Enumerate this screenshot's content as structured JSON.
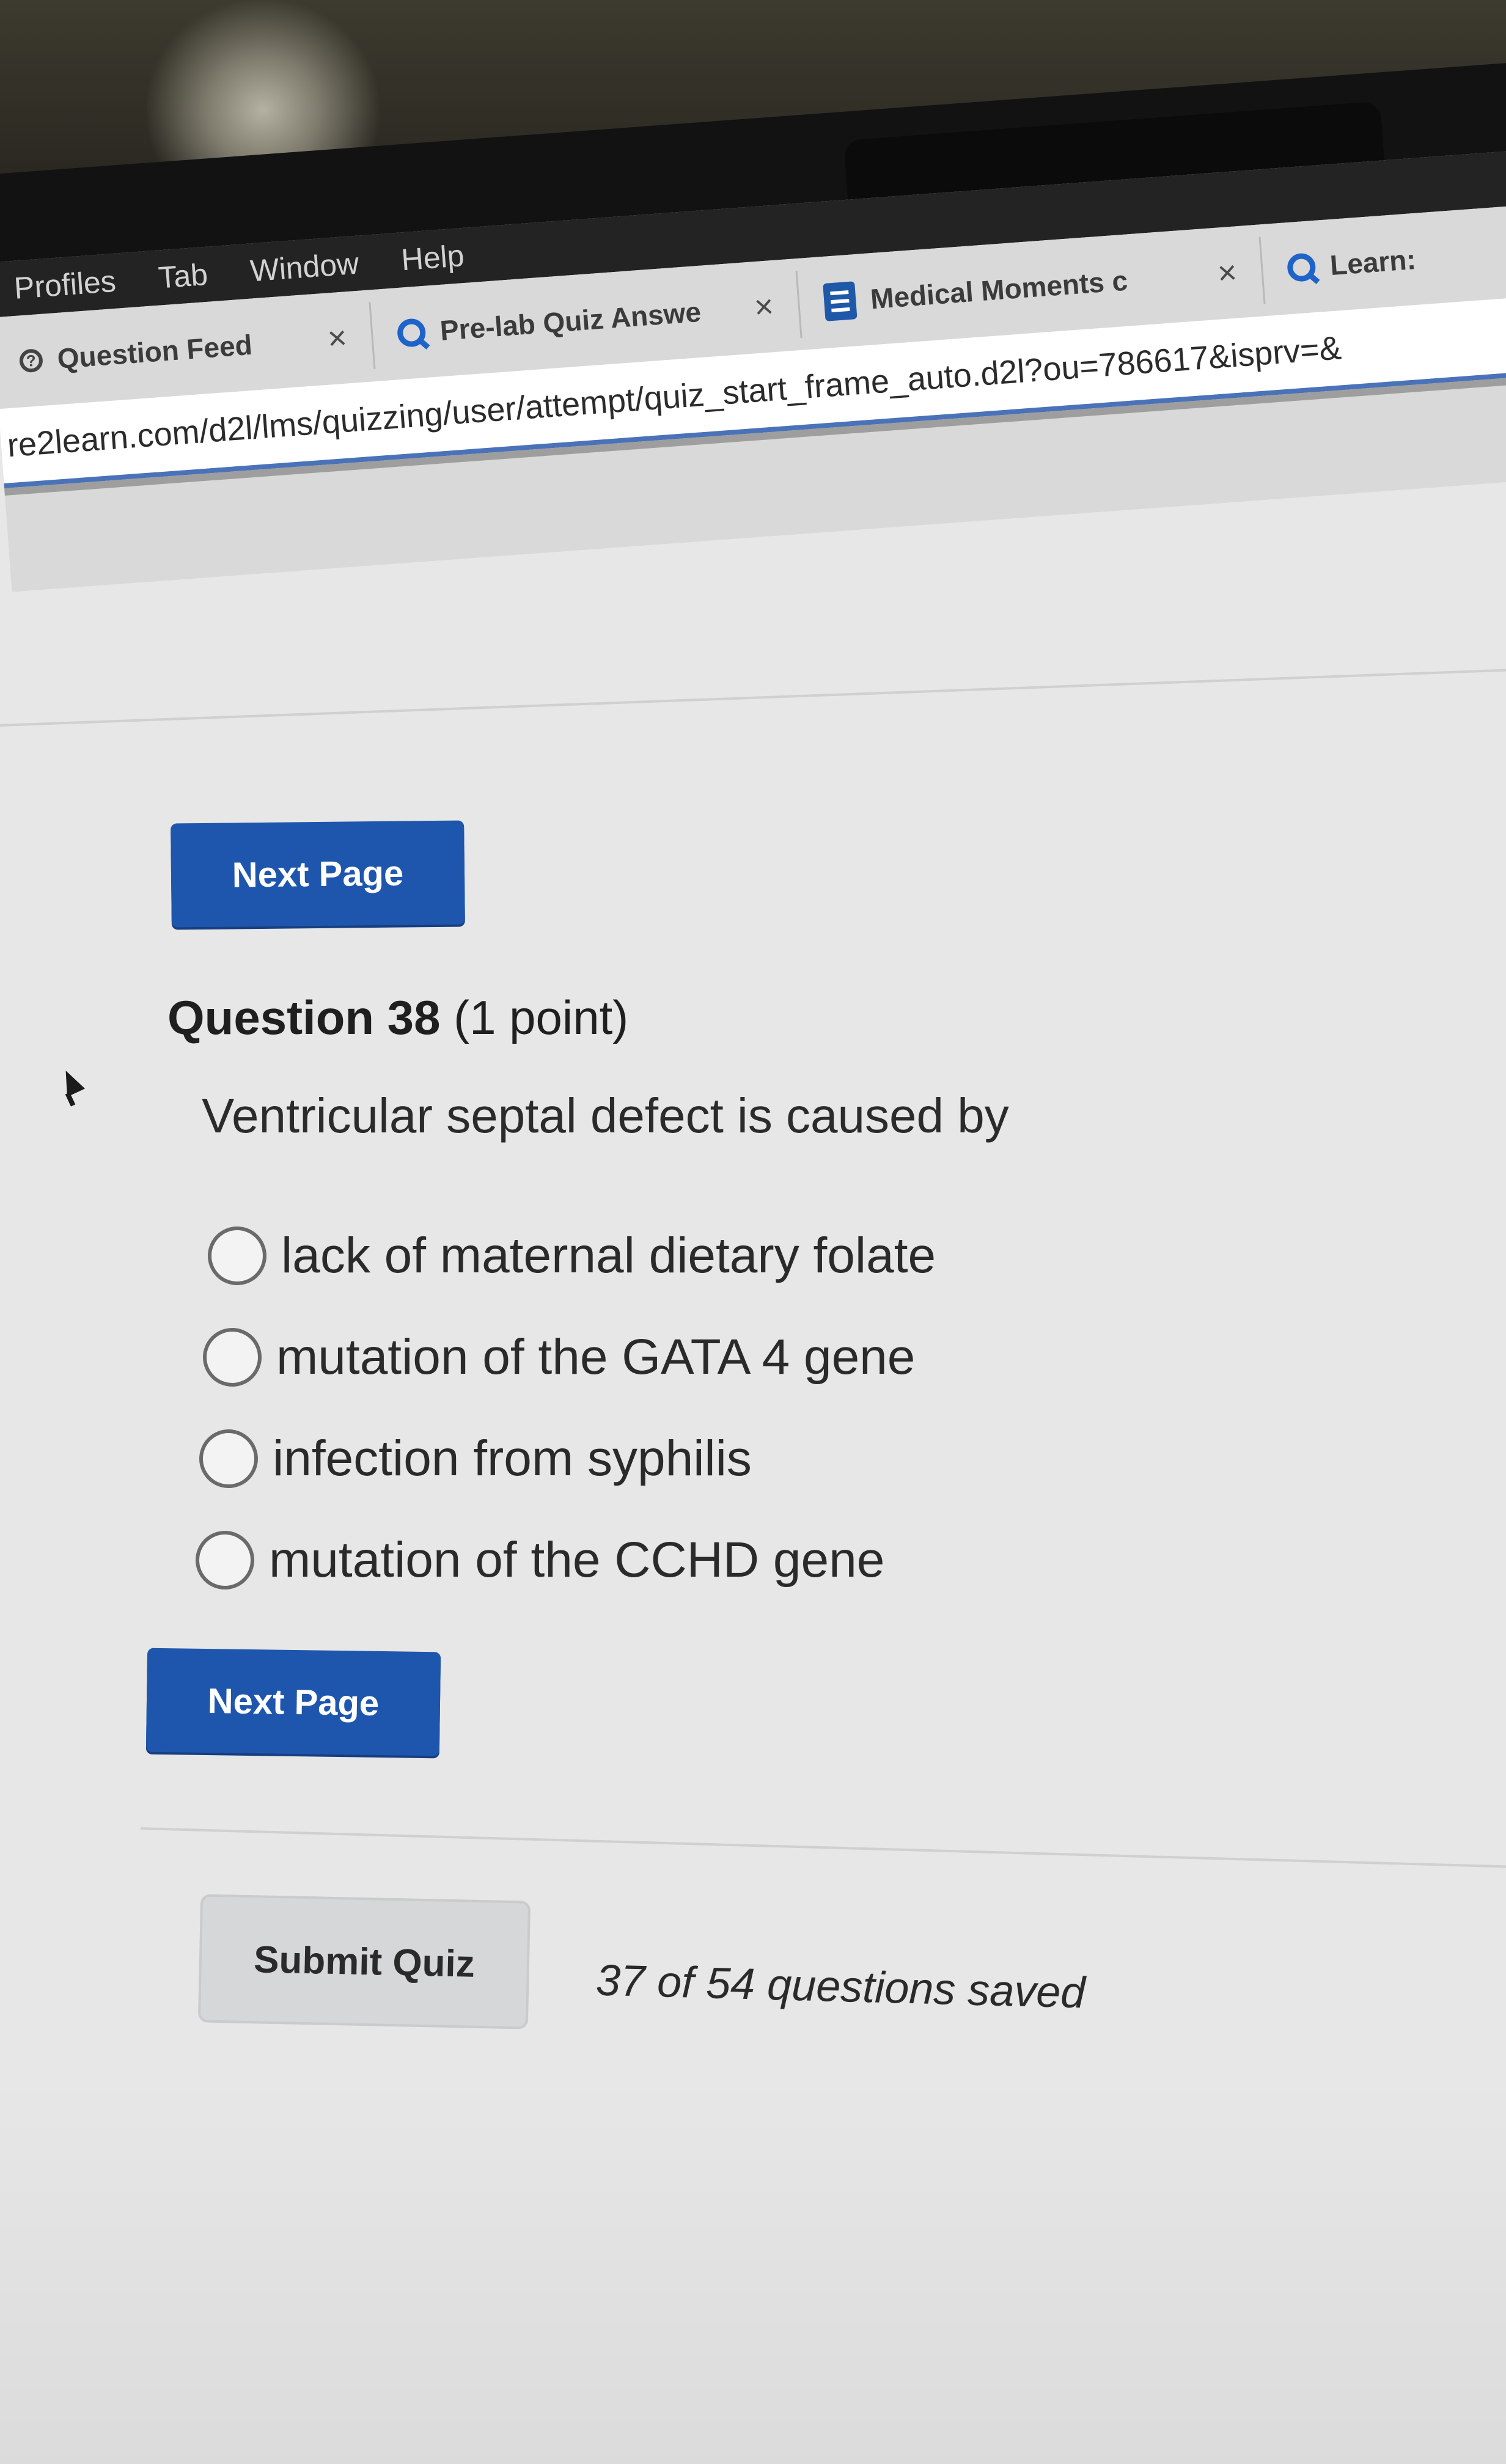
{
  "menubar": {
    "items": [
      "Profiles",
      "Tab",
      "Window",
      "Help"
    ]
  },
  "tabs": [
    {
      "label": "Question Feed",
      "icon": "help-circle-icon"
    },
    {
      "label": "Pre-lab Quiz Answe",
      "icon": "search-q-icon"
    },
    {
      "label": "Medical Moments c",
      "icon": "document-icon"
    },
    {
      "label": "Learn: ",
      "icon": "search-q-icon"
    }
  ],
  "address_bar": {
    "url": "re2learn.com/d2l/lms/quizzing/user/attempt/quiz_start_frame_auto.d2l?ou=786617&isprv=&"
  },
  "quiz": {
    "next_page_label": "Next Page",
    "question_number": "Question 38",
    "question_points": "(1 point)",
    "question_text": "Ventricular septal defect is caused by",
    "options": [
      "lack of maternal dietary folate",
      "mutation of the GATA 4 gene",
      "infection from syphilis",
      "mutation of the CCHD gene"
    ],
    "submit_label": "Submit Quiz",
    "saved_status": "37 of 54 questions saved"
  }
}
